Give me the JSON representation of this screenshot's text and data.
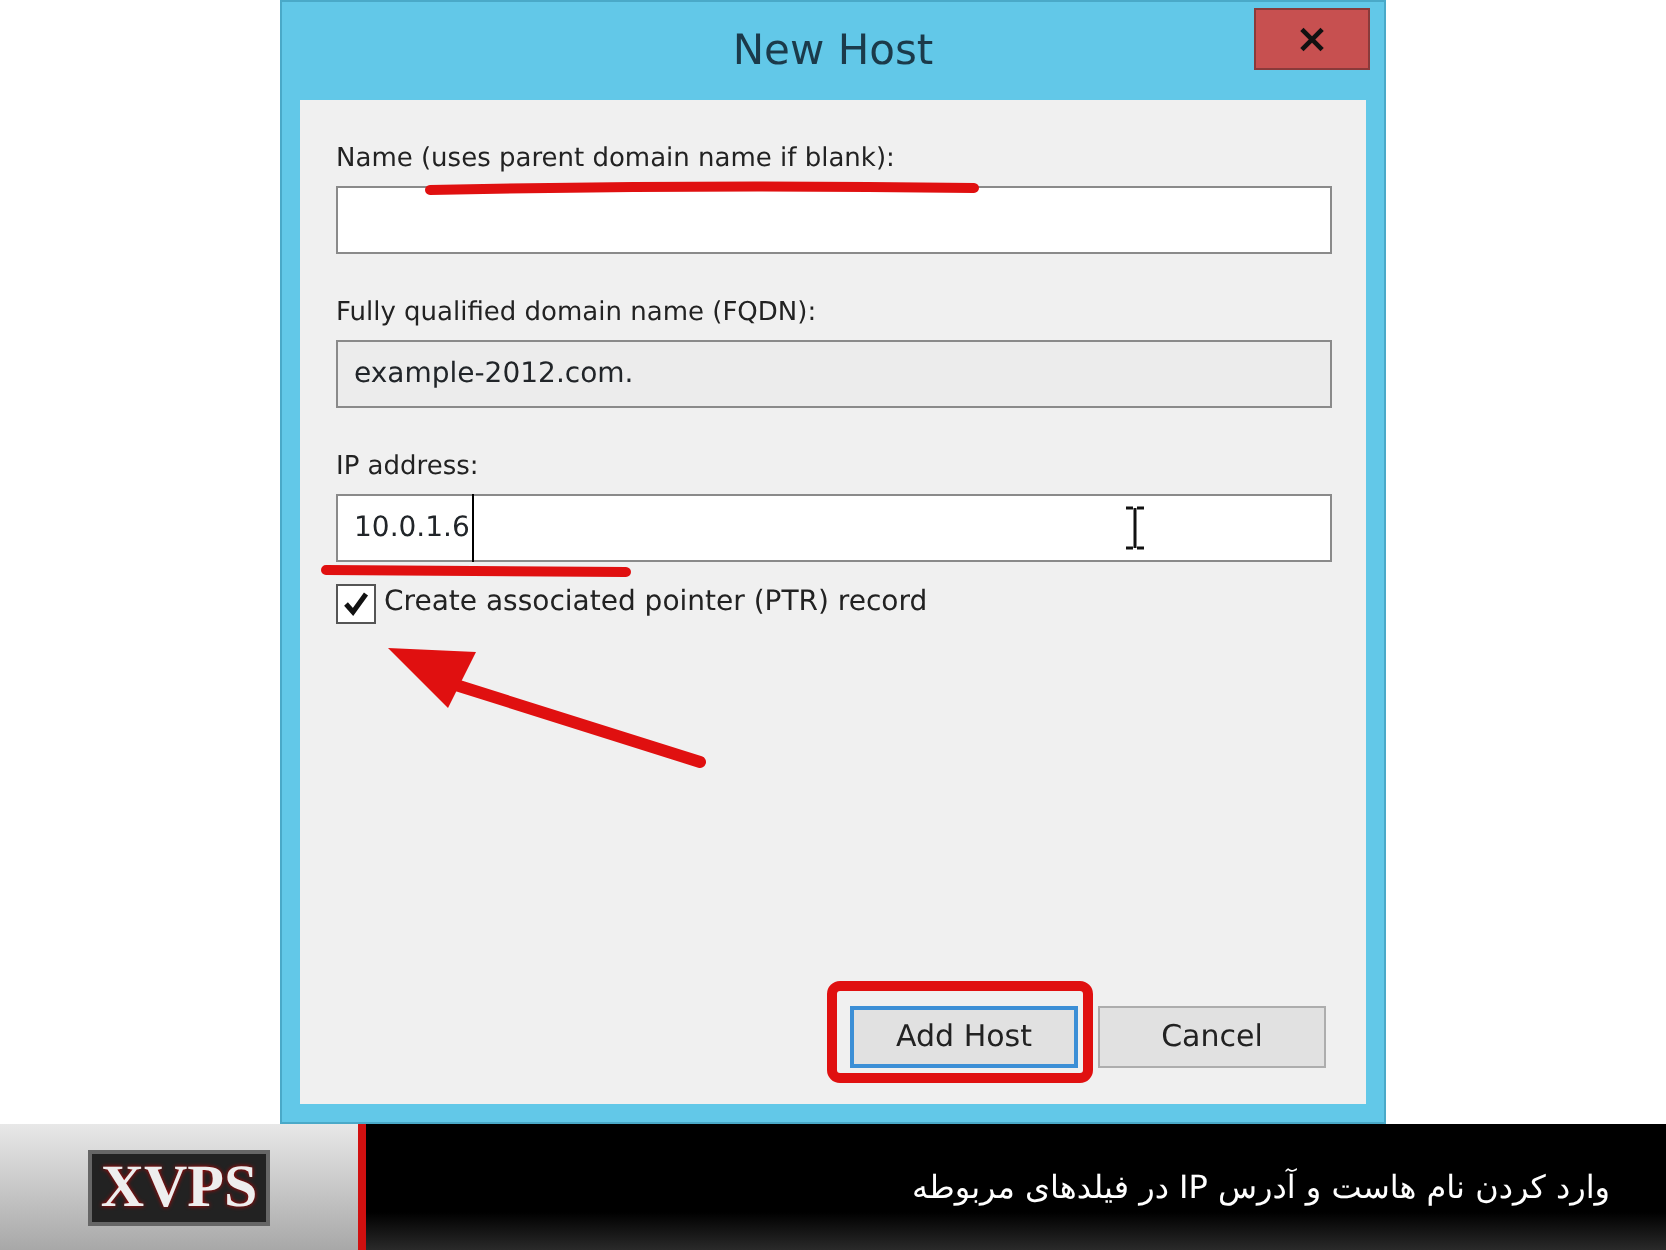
{
  "window": {
    "title": "New Host",
    "close": "×"
  },
  "fields": [
    {
      "label": "Name (uses parent domain name if blank):",
      "disabled": false
    },
    {
      "label": "Fully qualified domain name (FQDN):",
      "value": "example-2012.com.",
      "disabled": true
    },
    {
      "label": "IP address:",
      "value": "10.0.1.6",
      "disabled": false
    }
  ],
  "checkbox": {
    "label": "Create associated pointer (PTR) record",
    "checked": true
  },
  "buttons": [
    {
      "label": "Add Host",
      "default": true
    },
    {
      "label": "Cancel",
      "default": false
    }
  ],
  "banner": {
    "logo": "XVPS",
    "caption": "وارد کردن نام هاست و آدرس IP در فیلدهای مربوطه"
  }
}
